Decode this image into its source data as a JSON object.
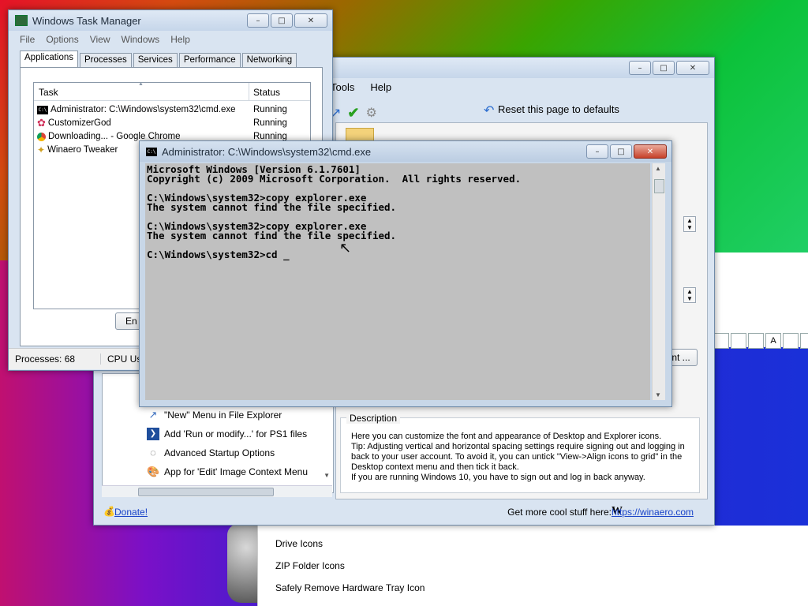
{
  "taskmgr": {
    "title": "Windows Task Manager",
    "menu": [
      "File",
      "Options",
      "View",
      "Windows",
      "Help"
    ],
    "tabs": [
      "Applications",
      "Processes",
      "Services",
      "Performance",
      "Networking"
    ],
    "columns": {
      "task": "Task",
      "status": "Status"
    },
    "rows": [
      {
        "task": "Administrator: C:\\Windows\\system32\\cmd.exe",
        "status": "Running",
        "icon": "cmd-icon"
      },
      {
        "task": "CustomizerGod",
        "status": "Running",
        "icon": "gear-flower-icon"
      },
      {
        "task": "Downloading... - Google Chrome",
        "status": "Running",
        "icon": "chrome-icon"
      },
      {
        "task": "Winaero Tweaker",
        "status": "",
        "icon": "winaero-icon"
      }
    ],
    "end_task_button": "En",
    "processes": "Processes: 68",
    "cpu": "CPU Usag"
  },
  "winaero": {
    "menu": [
      "Tools",
      "Help"
    ],
    "reset": "Reset this page to defaults",
    "tree_items": [
      {
        "label": "\"New\" Menu in File Explorer",
        "icon": "new-menu-icon"
      },
      {
        "label": "Add 'Run or modify...' for PS1 files",
        "icon": "powershell-icon"
      },
      {
        "label": "Advanced Startup Options",
        "icon": "startup-icon"
      },
      {
        "label": "App for 'Edit' Image Context Menu",
        "icon": "paint-icon"
      }
    ],
    "description_title": "Description",
    "description": [
      "Here you can customize the font and appearance of Desktop and Explorer icons.",
      "Tip: Adjusting vertical and horizontal spacing settings require signing out and logging in",
      "back to your user account. To avoid it, you can untick \"View->Align icons to grid\" in the",
      "Desktop context menu and then tick it back.",
      "If you are running Windows 10, you have to sign out and log in back anyway."
    ],
    "donate": "Donate!",
    "getmore": "Get more cool stuff here:",
    "link": "https://winaero.com",
    "nt_button": "nt ..."
  },
  "cmd": {
    "title": "Administrator: C:\\Windows\\system32\\cmd.exe",
    "lines": [
      "Microsoft Windows [Version 6.1.7601]",
      "Copyright (c) 2009 Microsoft Corporation.  All rights reserved.",
      "",
      "C:\\Windows\\system32>copy explorer.exe",
      "The system cannot find the file specified.",
      "",
      "C:\\Windows\\system32>copy explorer.exe",
      "The system cannot find the file specified.",
      "",
      "C:\\Windows\\system32>cd _"
    ]
  },
  "bg_panel": {
    "items": [
      "Drive Icons",
      "ZIP Folder Icons",
      "Safely Remove Hardware Tray Icon"
    ]
  }
}
